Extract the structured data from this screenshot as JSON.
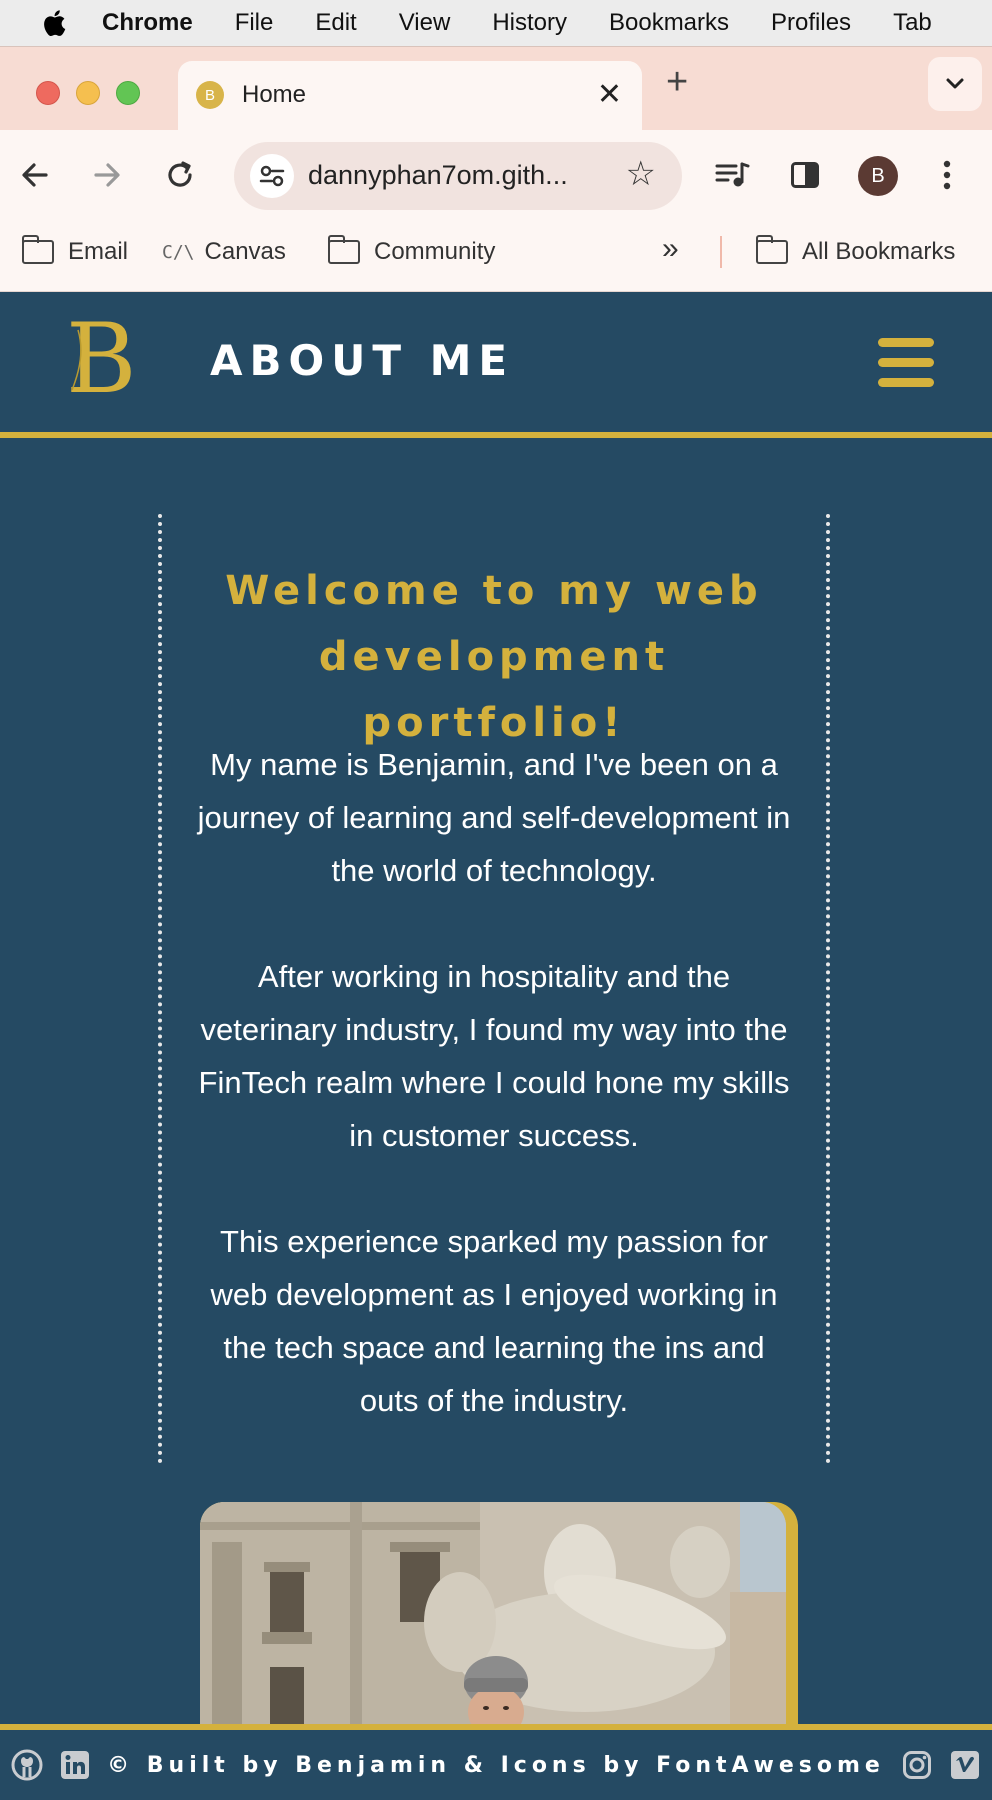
{
  "menubar": {
    "app_name": "Chrome",
    "items": [
      "File",
      "Edit",
      "View",
      "History",
      "Bookmarks",
      "Profiles",
      "Tab"
    ]
  },
  "tabs": [
    {
      "favicon_letter": "B",
      "title": "Home"
    }
  ],
  "toolbar": {
    "url": "dannyphan7om.gith...",
    "profile_letter": "B"
  },
  "bookmarks": {
    "items": [
      {
        "label": "Email",
        "icon": "folder-icon"
      },
      {
        "label": "Canvas",
        "icon": "canvas-icon",
        "glyph": "C/\\"
      },
      {
        "label": "Community",
        "icon": "folder-icon"
      }
    ],
    "overflow": "»",
    "all_bookmarks": "All Bookmarks"
  },
  "header": {
    "title": "ABOUT ME"
  },
  "content": {
    "heading": "Welcome to my web development portfolio!",
    "paragraphs": [
      "My name is Benjamin, and I've been on a journey of learning and self-development in the world of technology.",
      "After working in hospitality and the veterinary industry, I found my way into the FinTech realm where I could hone my skills in customer success.",
      "This experience sparked my passion for web development as I enjoyed working in the tech space and learning the ins and outs of the industry."
    ]
  },
  "footer": {
    "text": "© Built by Benjamin & Icons by FontAwesome"
  },
  "colors": {
    "page_background": "#254a63",
    "accent_gold": "#d4b13d",
    "text_white": "#ffffff",
    "tab_strip": "#f7dcd3"
  }
}
